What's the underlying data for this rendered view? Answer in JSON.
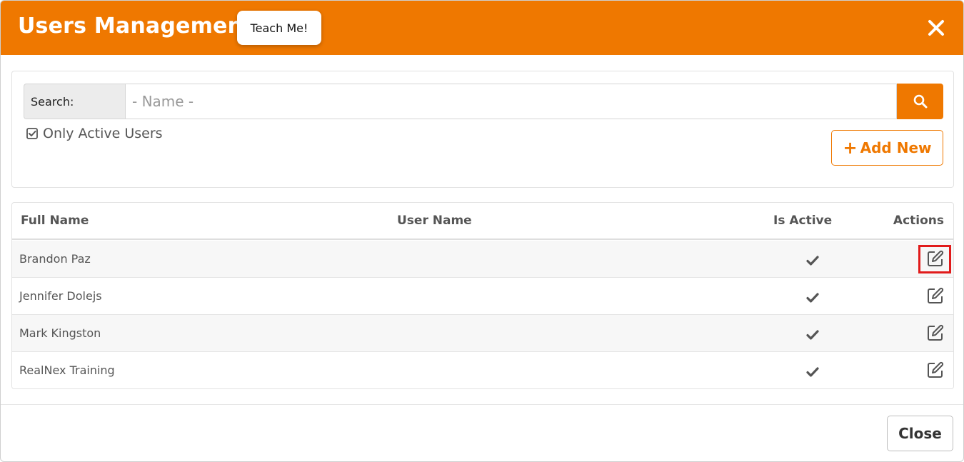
{
  "header": {
    "title": "Users Management",
    "teach_label": "Teach Me!",
    "accent_color": "#ef7800"
  },
  "search": {
    "label": "Search:",
    "placeholder": "- Name -",
    "value": "",
    "button_icon": "search-icon"
  },
  "filter": {
    "only_active_label": "Only Active Users",
    "only_active_checked": true
  },
  "toolbar": {
    "add_new_label": "Add New"
  },
  "table": {
    "columns": [
      "Full Name",
      "User Name",
      "Is Active",
      "Actions"
    ],
    "rows": [
      {
        "full_name": "Brandon Paz",
        "user_name": "",
        "is_active": true
      },
      {
        "full_name": "Jennifer Dolejs",
        "user_name": "",
        "is_active": true
      },
      {
        "full_name": "Mark Kingston",
        "user_name": "",
        "is_active": true
      },
      {
        "full_name": "RealNex Training",
        "user_name": "",
        "is_active": true
      }
    ]
  },
  "footer": {
    "close_label": "Close"
  }
}
